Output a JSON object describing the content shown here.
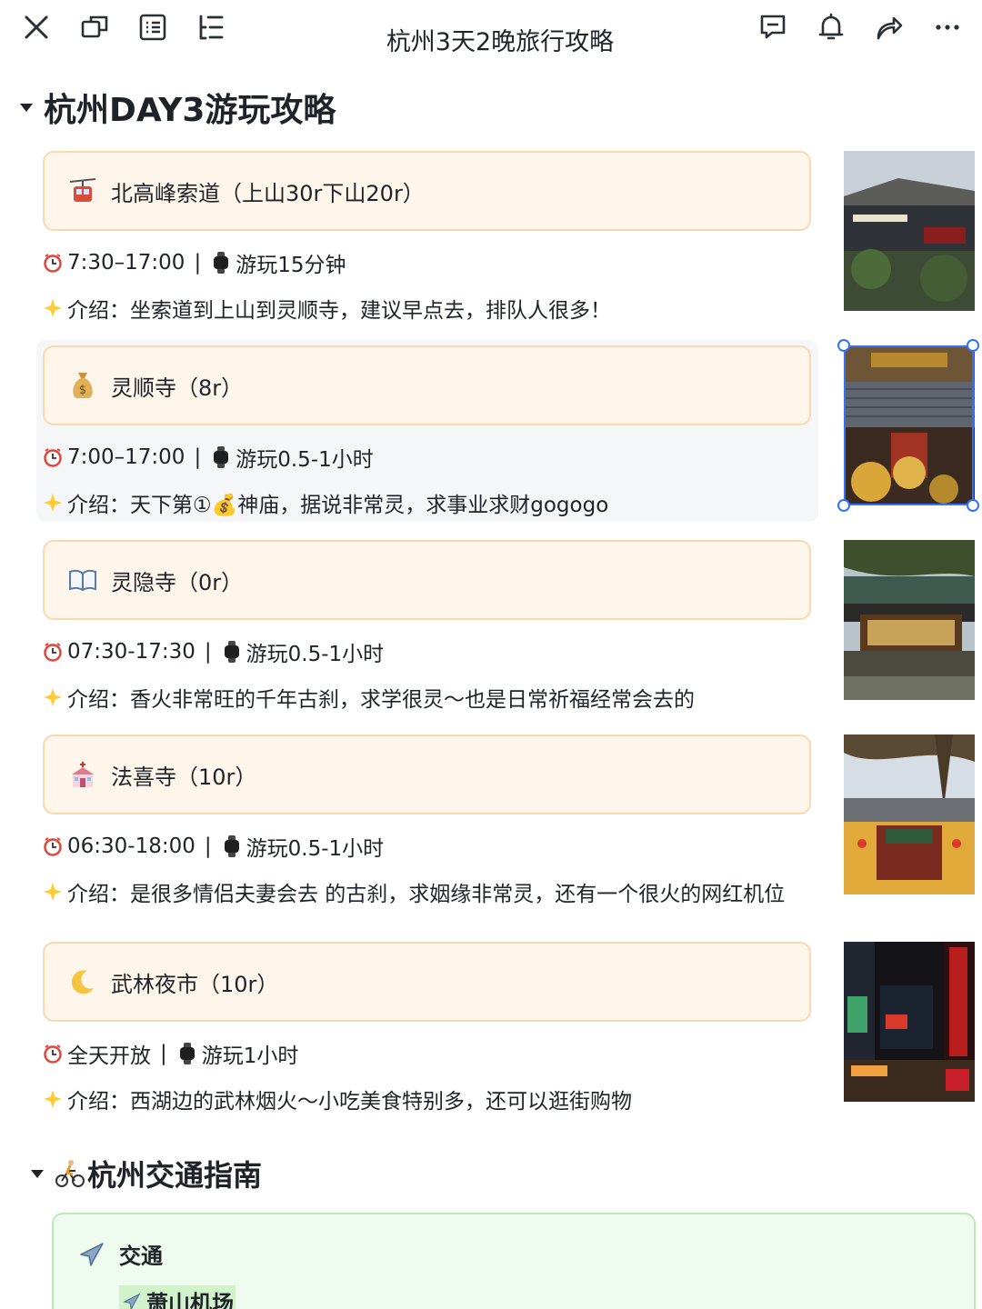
{
  "header": {
    "title": "杭州3天2晚旅行攻略",
    "icons": [
      "close-icon",
      "window-icon",
      "outline-icon",
      "toc-icon",
      "comment-icon",
      "bell-icon",
      "share-icon",
      "more-icon"
    ]
  },
  "section1": {
    "title": "杭州DAY3游玩攻略"
  },
  "spots": [
    {
      "icon": "cable-car-emoji",
      "name": "北高峰索道（上山30r下山20r）",
      "hours": "7:30–17:00",
      "duration": "游玩15分钟",
      "intro_prefix": "介绍：",
      "intro": "坐索道到上山到灵顺寺，建议早点去，排队人很多！",
      "photo": "cableway-station-photo"
    },
    {
      "icon": "money-bag-emoji",
      "name": "灵顺寺（8r）",
      "hours": "7:00–17:00",
      "duration": "游玩0.5-1小时",
      "intro_prefix": "介绍：",
      "intro": "天下第①💰神庙，据说非常灵，求事业求财gogogo",
      "photo": "lingshun-temple-photo"
    },
    {
      "icon": "open-book-emoji",
      "name": "灵隐寺（0r）",
      "hours": "07:30-17:30",
      "duration": "游玩0.5-1小时",
      "intro_prefix": "介绍：",
      "intro": "香火非常旺的千年古刹，求学很灵～也是日常祈福经常会去的",
      "photo": "lingyin-temple-photo"
    },
    {
      "icon": "wedding-chapel-emoji",
      "name": "法喜寺（10r）",
      "hours": "06:30-18:00",
      "duration": "游玩0.5-1小时",
      "intro_prefix": "介绍：",
      "intro": "是很多情侣夫妻会去 的古刹，求姻缘非常灵，还有一个很火的网红机位",
      "photo": "faxi-temple-photo"
    },
    {
      "icon": "crescent-moon-emoji",
      "name": "武林夜市（10r）",
      "hours": "全天开放",
      "duration": "游玩1小时",
      "intro_prefix": "介绍：",
      "intro": "西湖边的武林烟火～小吃美食特别多，还可以逛街购物",
      "photo": "wulin-night-market-photo"
    }
  ],
  "section2": {
    "title": "杭州交通指南"
  },
  "transport": {
    "heading": "交通",
    "item": "萧山机场"
  },
  "colors": {
    "callout_bg": "#fff6eb",
    "callout_border": "#fbd8ae",
    "selection": "#3370ff",
    "green_bg": "#f0fbef",
    "green_border": "#b7edb1"
  }
}
